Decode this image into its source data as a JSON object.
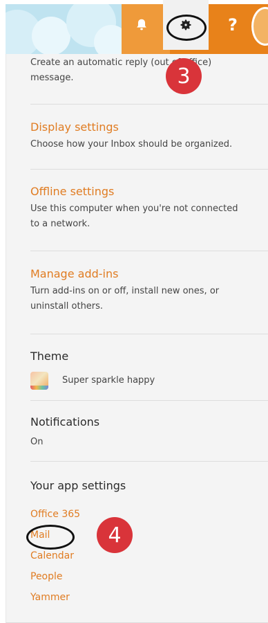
{
  "header": {
    "help_label": "?"
  },
  "auto_reply": {
    "line1": "Create an automatic reply (out of office)",
    "line2": "message."
  },
  "display_settings": {
    "title": "Display settings",
    "description": "Choose how your Inbox should be organized."
  },
  "offline_settings": {
    "title": "Offline settings",
    "description_line1": "Use this computer when you're not connected",
    "description_line2": "to a network."
  },
  "manage_addins": {
    "title": "Manage add-ins",
    "description_line1": "Turn add-ins on or off, install new ones, or",
    "description_line2": "uninstall others."
  },
  "theme": {
    "heading": "Theme",
    "value": "Super sparkle happy"
  },
  "notifications": {
    "heading": "Notifications",
    "value": "On"
  },
  "app_settings": {
    "heading": "Your app settings",
    "links": [
      "Office 365",
      "Mail",
      "Calendar",
      "People",
      "Yammer"
    ]
  },
  "annotations": {
    "step3": "3",
    "step4": "4"
  },
  "colors": {
    "link_orange": "#e07c22",
    "banner_orange": "#e8821a",
    "badge_red": "#d9343a",
    "panel_bg": "#f4f4f4"
  },
  "icons": [
    "bell-icon",
    "gear-icon",
    "help-icon",
    "theme-swatch-icon"
  ]
}
